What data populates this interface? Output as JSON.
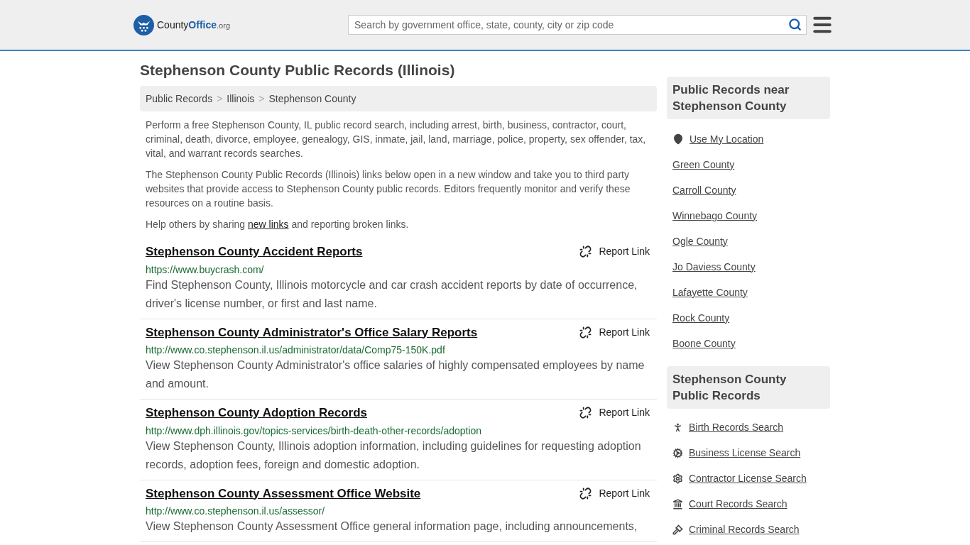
{
  "header": {
    "logo": {
      "name": "County",
      "accent": "Office",
      "suffix": ".org"
    },
    "search": {
      "placeholder": "Search by government office, state, county, city or zip code"
    }
  },
  "title": "Stephenson County Public Records (Illinois)",
  "breadcrumbs": [
    "Public Records",
    "Illinois",
    "Stephenson County"
  ],
  "breadcrumb_separators": [
    ">",
    ">"
  ],
  "intro": [
    "Perform a free Stephenson County, IL public record search, including arrest, birth, business, contractor, court, criminal, death, divorce, employee, genealogy, GIS, inmate, jail, land, marriage, police, property, sex offender, tax, vital, and warrant records searches.",
    "The Stephenson County Public Records (Illinois) links below open in a new window and take you to third party websites that provide access to Stephenson County public records. Editors frequently monitor and verify these resources on a routine basis."
  ],
  "help": {
    "before": "Help others by sharing",
    "link": "new links",
    "after": "and reporting broken links."
  },
  "records": [
    {
      "report_label": "Report Link",
      "title": "Stephenson County Accident Reports",
      "url": "https://www.buycrash.com/",
      "description": "Find Stephenson County, Illinois motorcycle and car crash accident reports by date of occurrence, driver's license number, or first and last name."
    },
    {
      "report_label": "Report Link",
      "title": "Stephenson County Administrator's Office Salary Reports",
      "url": "http://www.co.stephenson.il.us/administrator/data/Comp75-150K.pdf",
      "description": "View Stephenson County Administrator's office salaries of highly compensated employees by name and amount."
    },
    {
      "report_label": "Report Link",
      "title": "Stephenson County Adoption Records",
      "url": "http://www.dph.illinois.gov/topics-services/birth-death-other-records/adoption",
      "description": "View Stephenson County, Illinois adoption information, including guidelines for requesting adoption records, adoption fees, foreign and domestic adoption."
    },
    {
      "report_label": "Report Link",
      "title": "Stephenson County Assessment Office Website",
      "url": "http://www.co.stephenson.il.us/assessor/",
      "description": "View Stephenson County Assessment Office general information page, including announcements,"
    }
  ],
  "nearby": {
    "heading": "Public Records near Stephenson County",
    "location": "Use My Location",
    "counties": [
      "Green County",
      "Carroll County",
      "Winnebago County",
      "Ogle County",
      "Jo Daviess County",
      "Lafayette County",
      "Rock County",
      "Boone County"
    ]
  },
  "county_records": {
    "heading": "Stephenson County Public Records",
    "links": [
      {
        "kind": "birth",
        "label": "Birth Records Search"
      },
      {
        "kind": "business",
        "label": "Business License Search"
      },
      {
        "kind": "contractor",
        "label": "Contractor License Search"
      },
      {
        "kind": "court",
        "label": "Court Records Search"
      },
      {
        "kind": "criminal",
        "label": "Criminal Records Search"
      }
    ]
  }
}
